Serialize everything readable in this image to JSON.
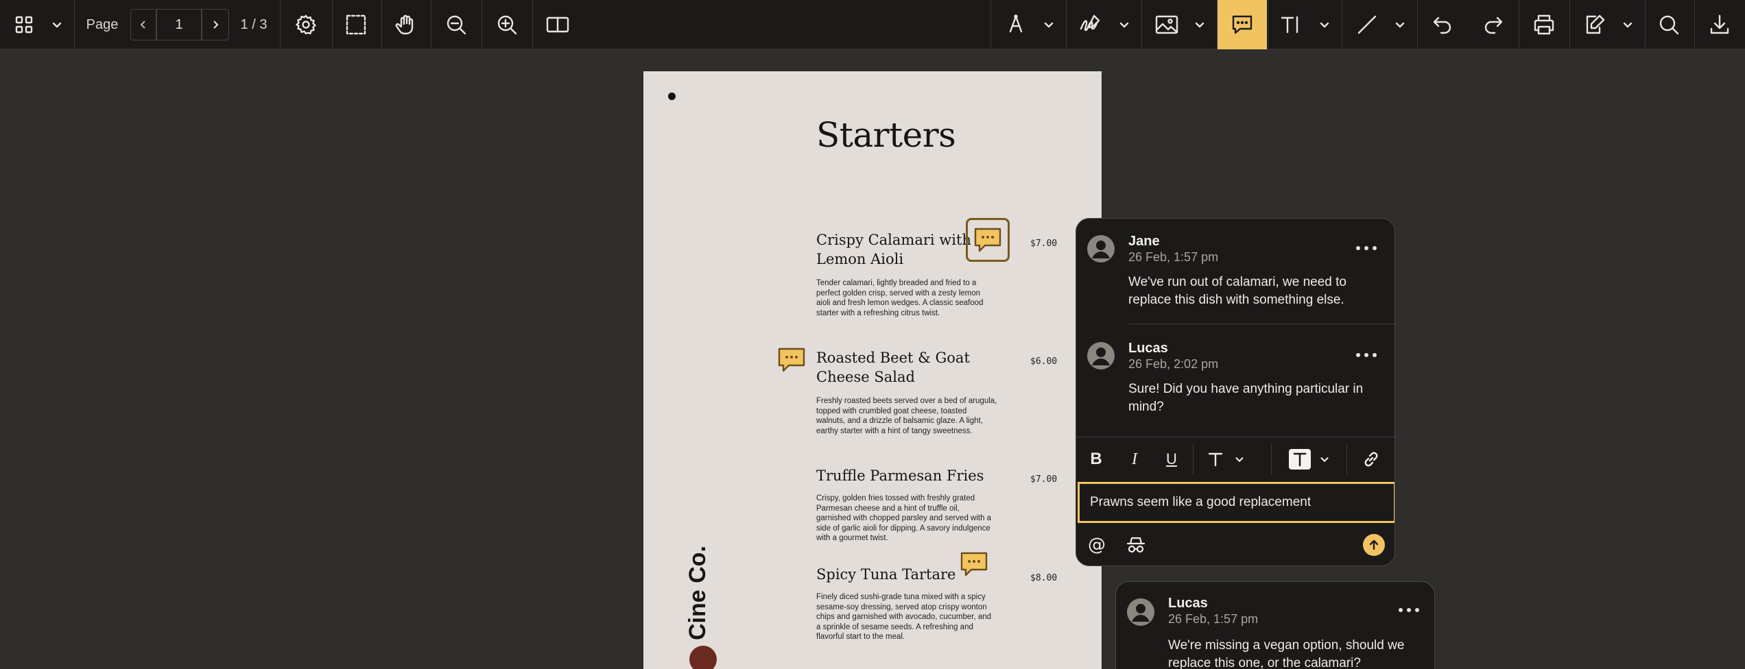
{
  "toolbar": {
    "page_label": "Page",
    "page_value": "1",
    "page_count": "1 / 3"
  },
  "document": {
    "title": "Starters",
    "brand": "Cine Co.",
    "items": [
      {
        "name": "Crispy Calamari with Lemon Aioli",
        "price": "$7.00",
        "description": "Tender calamari, lightly breaded and fried to a perfect golden crisp, served with a zesty lemon aioli and fresh lemon wedges. A classic seafood starter with a refreshing citrus twist."
      },
      {
        "name": "Roasted Beet & Goat Cheese Salad",
        "price": "$6.00",
        "description": "Freshly roasted beets served over a bed of arugula, topped with crumbled goat cheese, toasted walnuts, and a drizzle of balsamic glaze. A light, earthy starter with a hint of tangy sweetness."
      },
      {
        "name": "Truffle Parmesan Fries",
        "price": "$7.00",
        "description": "Crispy, golden fries tossed with freshly grated Parmesan cheese and a hint of truffle oil, garnished with chopped parsley and served with a side of garlic aioli for dipping. A savory indulgence with a gourmet twist."
      },
      {
        "name": "Spicy Tuna Tartare",
        "price": "$8.00",
        "description": "Finely diced sushi-grade tuna mixed with a spicy sesame-soy dressing, served atop crispy wonton chips and garnished with avocado, cucumber, and a sprinkle of sesame seeds. A refreshing and flavorful start to the meal."
      }
    ]
  },
  "thread": {
    "comments": [
      {
        "author": "Jane",
        "date": "26 Feb, 1:57 pm",
        "text": "We've run out of calamari, we need to replace this dish with something else."
      },
      {
        "author": "Lucas",
        "date": "26 Feb, 2:02 pm",
        "text": "Sure! Did you have anything particular in mind?"
      }
    ],
    "reply_value": "Prawns seem like a good replacement"
  },
  "thread2": {
    "comments": [
      {
        "author": "Lucas",
        "date": "26 Feb, 1:57 pm",
        "text": "We're missing a vegan option, should we replace this one, or the calamari?"
      }
    ]
  },
  "colors": {
    "accent": "#f2c461",
    "toolbar_bg": "#1c1a19",
    "canvas_bg": "#2f2e2d",
    "page_bg": "#e2ddd9"
  },
  "icons": [
    "grid-icon",
    "settings-icon",
    "marquee-select-icon",
    "hand-pan-icon",
    "zoom-out-icon",
    "zoom-in-icon",
    "two-page-view-icon",
    "pen-icon",
    "signature-icon",
    "image-icon",
    "comment-icon",
    "text-tool-icon",
    "line-icon",
    "undo-icon",
    "redo-icon",
    "print-icon",
    "form-edit-icon",
    "search-icon",
    "download-icon"
  ]
}
